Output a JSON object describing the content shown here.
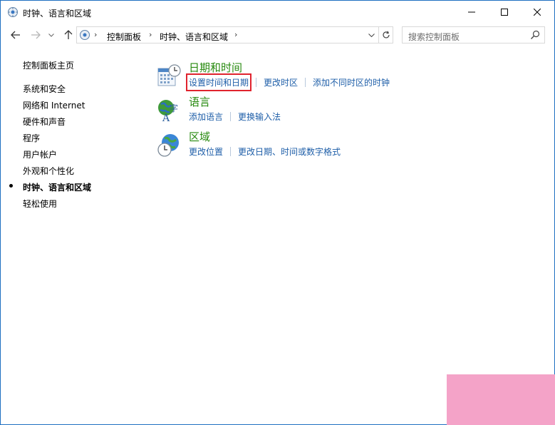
{
  "window": {
    "title": "时钟、语言和区域",
    "title_icon": "control-panel-icon",
    "minimize_icon": "minimize-icon",
    "maximize_icon": "maximize-icon",
    "close_icon": "close-icon"
  },
  "address_bar": {
    "breadcrumbs": [
      "控制面板",
      "时钟、语言和区域"
    ],
    "search_placeholder": "搜索控制面板"
  },
  "sidebar": {
    "home": "控制面板主页",
    "items": [
      {
        "label": "系统和安全",
        "active": false
      },
      {
        "label": "网络和 Internet",
        "active": false
      },
      {
        "label": "硬件和声音",
        "active": false
      },
      {
        "label": "程序",
        "active": false
      },
      {
        "label": "用户帐户",
        "active": false
      },
      {
        "label": "外观和个性化",
        "active": false
      },
      {
        "label": "时钟、语言和区域",
        "active": true
      },
      {
        "label": "轻松使用",
        "active": false
      }
    ]
  },
  "categories": [
    {
      "title": "日期和时间",
      "icon": "calendar-clock-icon",
      "links": [
        "设置时间和日期",
        "更改时区",
        "添加不同时区的时钟"
      ]
    },
    {
      "title": "语言",
      "icon": "language-icon",
      "links": [
        "添加语言",
        "更换输入法"
      ]
    },
    {
      "title": "区域",
      "icon": "globe-clock-icon",
      "links": [
        "更改位置",
        "更改日期、时间或数字格式"
      ]
    }
  ],
  "colors": {
    "category_title": "#26890d",
    "link": "#1e5ea8",
    "highlight_box": "#e0232e",
    "window_border": "#1e6fc1"
  }
}
